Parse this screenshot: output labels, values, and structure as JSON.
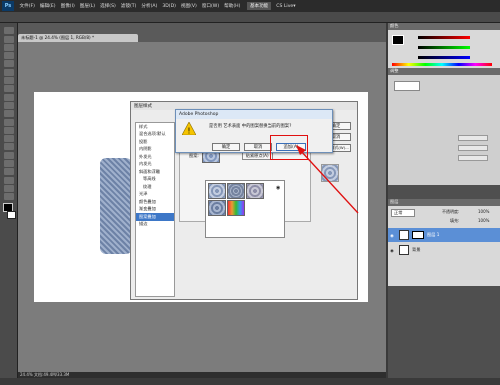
{
  "menubar": {
    "app_logo": "Ps",
    "items": [
      "文件(F)",
      "编辑(E)",
      "图像(I)",
      "图层(L)",
      "选择(S)",
      "滤镜(T)",
      "分析(A)",
      "3D(D)",
      "视图(V)",
      "窗口(W)",
      "帮助(H)"
    ],
    "workspace_label": "基本功能",
    "cslive_label": "CS Live▾"
  },
  "document": {
    "tab_label": "未标题-1 @ 24.4% (图层 1, RGB/8) *",
    "status_text": "24.4%   文档:49.4M/33.3M"
  },
  "style_dialog": {
    "title": "图层样式",
    "list_items": [
      "样式",
      "混合选项:默认",
      "投影",
      "内阴影",
      "外发光",
      "内发光",
      "斜面和浮雕",
      "等高线",
      "纹理",
      "光泽",
      "颜色叠加",
      "渐变叠加",
      "图案叠加",
      "描边"
    ],
    "selected_item": "图案叠加",
    "pattern_label": "图案:",
    "snap_button": "贴紧原点(A)",
    "right_buttons": [
      "确定",
      "取消",
      "新建样式(W)..."
    ]
  },
  "message_box": {
    "title": "Adobe Photoshop",
    "message": "是否用 艺术表面 中的图案替换当前的图案?",
    "buttons": {
      "ok": "确定",
      "cancel": "取消",
      "append": "追加(A)"
    }
  },
  "right_panels": {
    "color_tab": "颜色",
    "swatches_tab": "色板",
    "adjustments_tab": "调整",
    "masks_tab": "蒙版",
    "layers_tab": "图层",
    "blend_mode": "正常",
    "opacity_label": "不透明度:",
    "opacity_value": "100%",
    "fill_label": "填充:",
    "fill_value": "100%",
    "layers": [
      {
        "name": "图层 1",
        "selected": true
      },
      {
        "name": "背景",
        "selected": false
      }
    ]
  },
  "colors": {
    "accent_red": "#e01010",
    "selection_blue": "#3d77c7"
  }
}
